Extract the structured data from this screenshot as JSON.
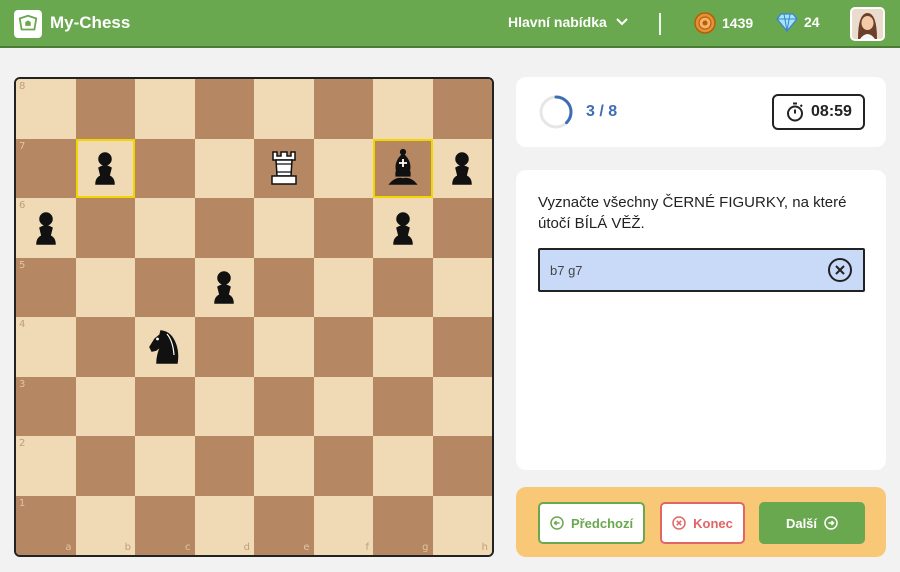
{
  "app": {
    "title": "My-Chess"
  },
  "header": {
    "main_menu_label": "Hlavní nabídka",
    "coins": "1439",
    "gems": "24"
  },
  "progress": {
    "text": "3 / 8",
    "fraction": 0.375
  },
  "timer": {
    "value": "08:59"
  },
  "task": {
    "question": "Vyznačte všechny ČERNÉ FIGURKY, na které útočí BÍLÁ VĚŽ.",
    "answer": "b7 g7"
  },
  "nav": {
    "prev_label": "Předchozí",
    "end_label": "Konec",
    "next_label": "Další"
  },
  "board": {
    "files": [
      "a",
      "b",
      "c",
      "d",
      "e",
      "f",
      "g",
      "h"
    ],
    "ranks": [
      "8",
      "7",
      "6",
      "5",
      "4",
      "3",
      "2",
      "1"
    ],
    "highlighted": [
      "b7",
      "g7"
    ],
    "pieces": [
      {
        "square": "b7",
        "piece": "pawn",
        "color": "black"
      },
      {
        "square": "e7",
        "piece": "rook",
        "color": "white"
      },
      {
        "square": "g7",
        "piece": "bishop",
        "color": "black"
      },
      {
        "square": "h7",
        "piece": "pawn",
        "color": "black"
      },
      {
        "square": "a6",
        "piece": "pawn",
        "color": "black"
      },
      {
        "square": "g6",
        "piece": "pawn",
        "color": "black"
      },
      {
        "square": "d5",
        "piece": "pawn",
        "color": "black"
      },
      {
        "square": "c4",
        "piece": "knight",
        "color": "black"
      }
    ]
  },
  "colors": {
    "header_green": "#6aa84f",
    "light_square": "#f0d9b5",
    "dark_square": "#b58863",
    "highlight": "#f2d600",
    "answer_bg": "#c9daf8",
    "nav_bg": "#f9c877",
    "accent_blue": "#3d6db5",
    "danger_red": "#e06666"
  }
}
